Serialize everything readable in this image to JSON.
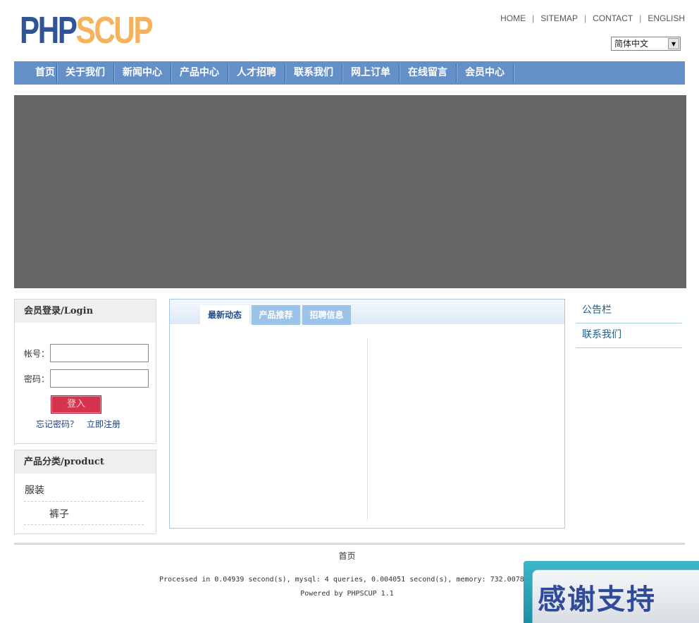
{
  "logo": {
    "part1": "PHP",
    "part2": "SCUP"
  },
  "top_links": [
    "HOME",
    "SITEMAP",
    "CONTACT",
    "ENGLISH"
  ],
  "language": {
    "selected": "简体中文"
  },
  "nav": [
    "首页",
    "关于我们",
    "新闻中心",
    "产品中心",
    "人才招聘",
    "联系我们",
    "网上订单",
    "在线留言",
    "会员中心"
  ],
  "login": {
    "title": "会员登录/Login",
    "account_label": "帐号：",
    "password_label": "密码：",
    "submit": "登入",
    "forgot": "忘记密码？",
    "register": "立即注册"
  },
  "product": {
    "title": "产品分类/product",
    "categories": [
      "服装",
      "裤子"
    ]
  },
  "tabs": [
    "最新动态",
    "产品推荐",
    "招聘信息"
  ],
  "side": [
    "公告栏",
    "联系我们"
  ],
  "footer": {
    "home": "首页",
    "processed": "Processed in 0.04939 second(s), mysql: 4 queries, 0.004051 second(s), memory: 732.0078",
    "powered": "Powered by PHPSCUP 1.1"
  },
  "thanks": "感谢支持"
}
